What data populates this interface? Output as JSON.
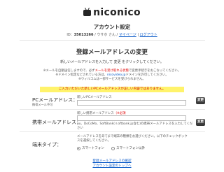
{
  "brand": {
    "logo_text": "niconico",
    "icon": "tv-icon"
  },
  "header": {
    "title": "アカウント設定",
    "id_label": "ID：",
    "user_id": "35013266",
    "user_suffix": " / ウサホ さん / ",
    "mypage_link": "マイページ",
    "separator": " | ",
    "logout_link": "ログアウト"
  },
  "section": {
    "title": "登録メールアドレスの変更",
    "lead": "新しいメールアドレスを入力して 変更 をクリックしてください。",
    "note_1_prefix": "※メールを自動送信しますので、必ず",
    "note_1_warn": "メールを受け取れる状態",
    "note_1_suffix": "で変更手続きをおこなってください。",
    "note_2_prefix": "※ドメイン指定などされている方は、",
    "note_2_domain": "nicovideo.jp",
    "note_2_suffix": "ドメインを許可してください。",
    "note_3": "※ウィルコムは一部サービスを受けられません。",
    "highlight": "ご入力いただいた新しいPCメールアドレスが正しい内容ではありません。"
  },
  "pc_mail": {
    "label": "PCメールアドレス：",
    "sub": "携帯メール不可",
    "hint": "新しいPCメールアドレス",
    "value": "新しいPCメールアドレス",
    "button": "変更"
  },
  "mobile_mail": {
    "label": "携帯メールアドレス：",
    "hint_prefix": "新しい携帯メールアドレス",
    "hint_required": "（※必須",
    "hint_example": "au、DoCoMo、SoftBank(ｓoftbank.jp含む)の携帯メールアドレスを入力してください",
    "value": "",
    "button": "変更"
  },
  "device": {
    "label": "端末タイプ：",
    "desc": "メールアドレスをあてまで端末の種類をお選びください。以下のチェックボックスを選択してください。",
    "options": [
      "スマートフォン",
      "スマートフォン以外"
    ],
    "selected": "スマートフォン"
  },
  "footer": {
    "link_1": "登録メールアドレスの確認",
    "link_2": "アカウント設定のトップへ"
  }
}
